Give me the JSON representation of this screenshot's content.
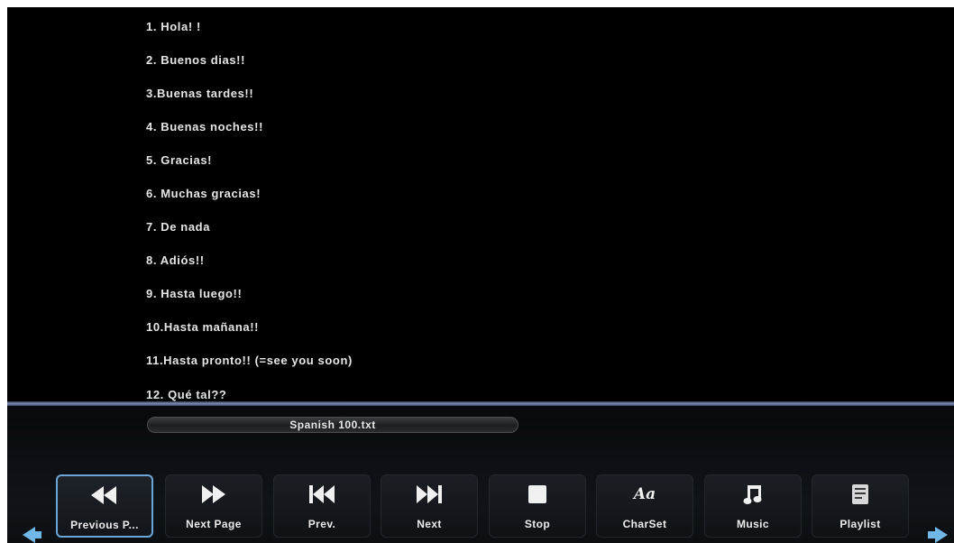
{
  "document": {
    "lines": [
      "1. Hola! !",
      "2. Buenos dias!!",
      "3.Buenas tardes!!",
      "4. Buenas noches!!",
      "5. Gracias!",
      "6. Muchas gracias!",
      "7. De nada",
      "8. Adiós!!",
      "9. Hasta luego!!",
      "10.Hasta mañana!!",
      "11.Hasta pronto!! (=see you soon)",
      "12. Qué tal??"
    ]
  },
  "file": {
    "name": "Spanish 100.txt"
  },
  "toolbar": {
    "buttons": [
      {
        "label": "Previous P...",
        "icon": "rewind-icon",
        "selected": true
      },
      {
        "label": "Next Page",
        "icon": "forward-icon",
        "selected": false
      },
      {
        "label": "Prev.",
        "icon": "skip-previous-icon",
        "selected": false
      },
      {
        "label": "Next",
        "icon": "skip-next-icon",
        "selected": false
      },
      {
        "label": "Stop",
        "icon": "stop-icon",
        "selected": false
      },
      {
        "label": "CharSet",
        "icon": "charset-icon",
        "glyph": "Aa",
        "selected": false
      },
      {
        "label": "Music",
        "icon": "music-note-icon",
        "selected": false
      },
      {
        "label": "Playlist",
        "icon": "playlist-icon",
        "selected": false
      }
    ]
  },
  "colors": {
    "accent": "#6aa6d6",
    "arrow": "#6fb8e8",
    "background": "#000000",
    "text": "#e6e6e6"
  }
}
